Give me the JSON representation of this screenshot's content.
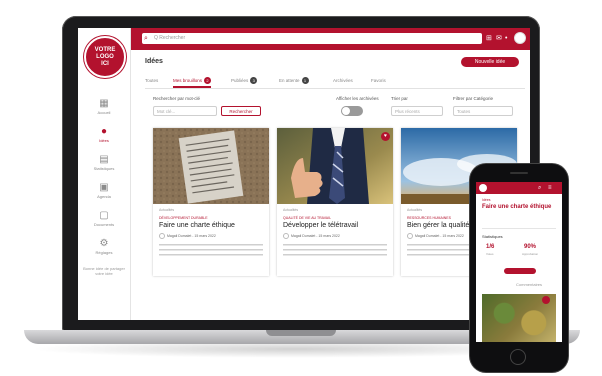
{
  "app": {
    "logo_text": [
      "VOTRE",
      "LOGO",
      "ICI"
    ],
    "search_placeholder": "Q Rechercher",
    "accent_color": "#b3122e"
  },
  "topbar_icons": [
    "search-icon",
    "grid-icon",
    "chat-icon",
    "bell-icon",
    "user-icon"
  ],
  "sidebar": {
    "items": [
      {
        "icon": "dashboard-icon",
        "label": "Accueil",
        "active": false
      },
      {
        "icon": "pin-icon",
        "label": "Idées",
        "active": true
      },
      {
        "icon": "stats-icon",
        "label": "Statistiques",
        "active": false
      },
      {
        "icon": "calendar-icon",
        "label": "Agenda",
        "active": false
      },
      {
        "icon": "document-icon",
        "label": "Documents",
        "active": false
      },
      {
        "icon": "gear-icon",
        "label": "Réglages",
        "active": false
      }
    ],
    "footer": "Bonne idée de partager votre idée"
  },
  "page": {
    "title": "Idées",
    "add_button": "Nouvelle idée"
  },
  "tabs": [
    {
      "label": "Toutes",
      "count": null,
      "active": false
    },
    {
      "label": "Mes brouillons",
      "count": "2",
      "active": true
    },
    {
      "label": "Publiées",
      "count": "3",
      "active": false
    },
    {
      "label": "En attente",
      "count": "1",
      "active": false
    },
    {
      "label": "Archivées",
      "count": null,
      "active": false
    },
    {
      "label": "Favoris",
      "count": null,
      "active": false
    }
  ],
  "filters": {
    "search_label": "Rechercher par mot-clé",
    "search_placeholder": "Mot clé...",
    "search_button": "Rechercher",
    "toggle_label": "Afficher les archivées",
    "sort_label": "Trier par",
    "sort_value": "Plus récents",
    "category_label": "Filtrer par Catégorie",
    "category_value": "Toutes"
  },
  "cards": [
    {
      "category": "Actualités",
      "tag": "DÉVELOPPEMENT DURABLE",
      "title": "Faire une charte éthique",
      "author": "Magali Dumalet - 15 mars 2022",
      "image": "paper-texture",
      "favorite": false
    },
    {
      "category": "Actualités",
      "tag": "QUALITÉ DE VIE AU TRAVAIL",
      "title": "Développer le télétravail",
      "author": "Magali Dumalet - 15 mars 2022",
      "image": "thumbs-up",
      "favorite": true
    },
    {
      "category": "Actualités",
      "tag": "RESSOURCES HUMAINES",
      "title": "Bien gérer la qualité",
      "author": "Magali Dumalet - 15 mars 2022",
      "image": "sky",
      "favorite": false
    }
  ],
  "phone": {
    "tag": "Idées",
    "title": "Faire une charte éthique",
    "subtitle": "Statistiques",
    "stats": [
      {
        "value": "1/6",
        "label": "Votes"
      },
      {
        "value": "90%",
        "label": "Approbation"
      }
    ],
    "button": "Je vote",
    "marker": "Commentaires"
  }
}
